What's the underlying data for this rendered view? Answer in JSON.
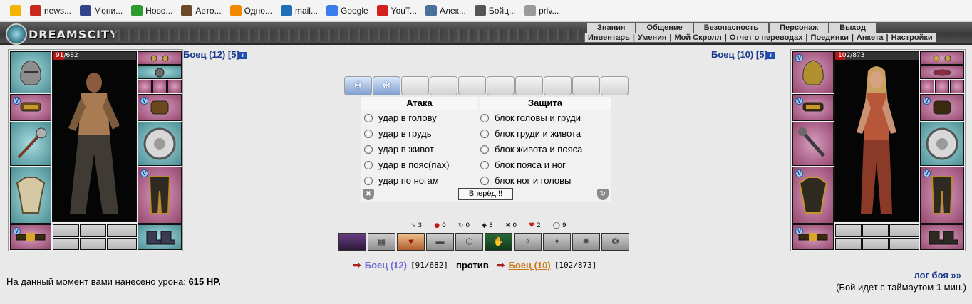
{
  "bookmarks": [
    {
      "label": "",
      "icon": "star-icon",
      "color": "#f2b400"
    },
    {
      "label": "news...",
      "icon": "news-icon",
      "color": "#c8281e"
    },
    {
      "label": "Мони...",
      "icon": "monitor-icon",
      "color": "#334488"
    },
    {
      "label": "Ново...",
      "icon": "novo-icon",
      "color": "#2f9a2f"
    },
    {
      "label": "Авто...",
      "icon": "auto-icon",
      "color": "#6b4a2a"
    },
    {
      "label": "Одно...",
      "icon": "ok-icon",
      "color": "#f08a00"
    },
    {
      "label": "mail...",
      "icon": "mail-icon",
      "color": "#1f6fb8"
    },
    {
      "label": "Google",
      "icon": "google-icon",
      "color": "#3b7bea"
    },
    {
      "label": "YouT...",
      "icon": "youtube-icon",
      "color": "#d21f1f"
    },
    {
      "label": "Алек...",
      "icon": "vk-icon",
      "color": "#4a6f9a"
    },
    {
      "label": "Бойц...",
      "icon": "swords-icon",
      "color": "#555555"
    },
    {
      "label": "priv...",
      "icon": "page-icon",
      "color": "#9a9a9a"
    }
  ],
  "header": {
    "logo": "DREAMSCITY",
    "nav": [
      "Знания",
      "Общение",
      "Безопасность",
      "Персонаж",
      "Выход"
    ],
    "subnav": [
      "Инвентарь",
      "Умения",
      "Мой Скролл",
      "Отчет о переводах",
      "Поединки",
      "Анкета",
      "Настройки"
    ]
  },
  "left_fighter": {
    "name": "Боец (12)",
    "level": "[5]",
    "info": "i",
    "hp_text": "91/682",
    "hp_current": 91,
    "hp_max": 682
  },
  "right_fighter": {
    "name": "Боец (10)",
    "level": "[5]",
    "info": "i",
    "hp_text": "102/873",
    "hp_current": 102,
    "hp_max": 873
  },
  "scrolls": {
    "active": 2,
    "total": 10
  },
  "attack": {
    "title": "Атака",
    "options": [
      "удар в голову",
      "удар в грудь",
      "удар в живот",
      "удар в пояс(пах)",
      "удар по ногам"
    ]
  },
  "defense": {
    "title": "Защита",
    "options": [
      "блок головы и груди",
      "блок груди и живота",
      "блок живота и пояса",
      "блок пояса и ног",
      "блок ног и головы"
    ]
  },
  "go_button": "Вперёд!!!",
  "stats": [
    {
      "icon": "strike-icon",
      "symbol": "➘",
      "value": "3"
    },
    {
      "icon": "blood-icon",
      "symbol": "●",
      "value": "0"
    },
    {
      "icon": "counter-icon",
      "symbol": "↻",
      "value": "0"
    },
    {
      "icon": "block-icon",
      "symbol": "◆",
      "value": "3"
    },
    {
      "icon": "crit-icon",
      "symbol": "✖",
      "value": "0"
    },
    {
      "icon": "heart-icon",
      "symbol": "♥",
      "value": "2"
    },
    {
      "icon": "shield-icon",
      "symbol": "◯",
      "value": "9"
    }
  ],
  "versus": {
    "left": "Боец (12)",
    "left_hp": "[91/682]",
    "against": "против",
    "right": "Боец (10)",
    "right_hp": "[102/873]"
  },
  "damage": {
    "prefix": "На данный момент вами нанесено урона:",
    "value": "615 HP."
  },
  "log": "лог боя »»",
  "timeout": {
    "before": "(Бой идет с таймаутом",
    "value": "1",
    "after": "мин.)"
  }
}
